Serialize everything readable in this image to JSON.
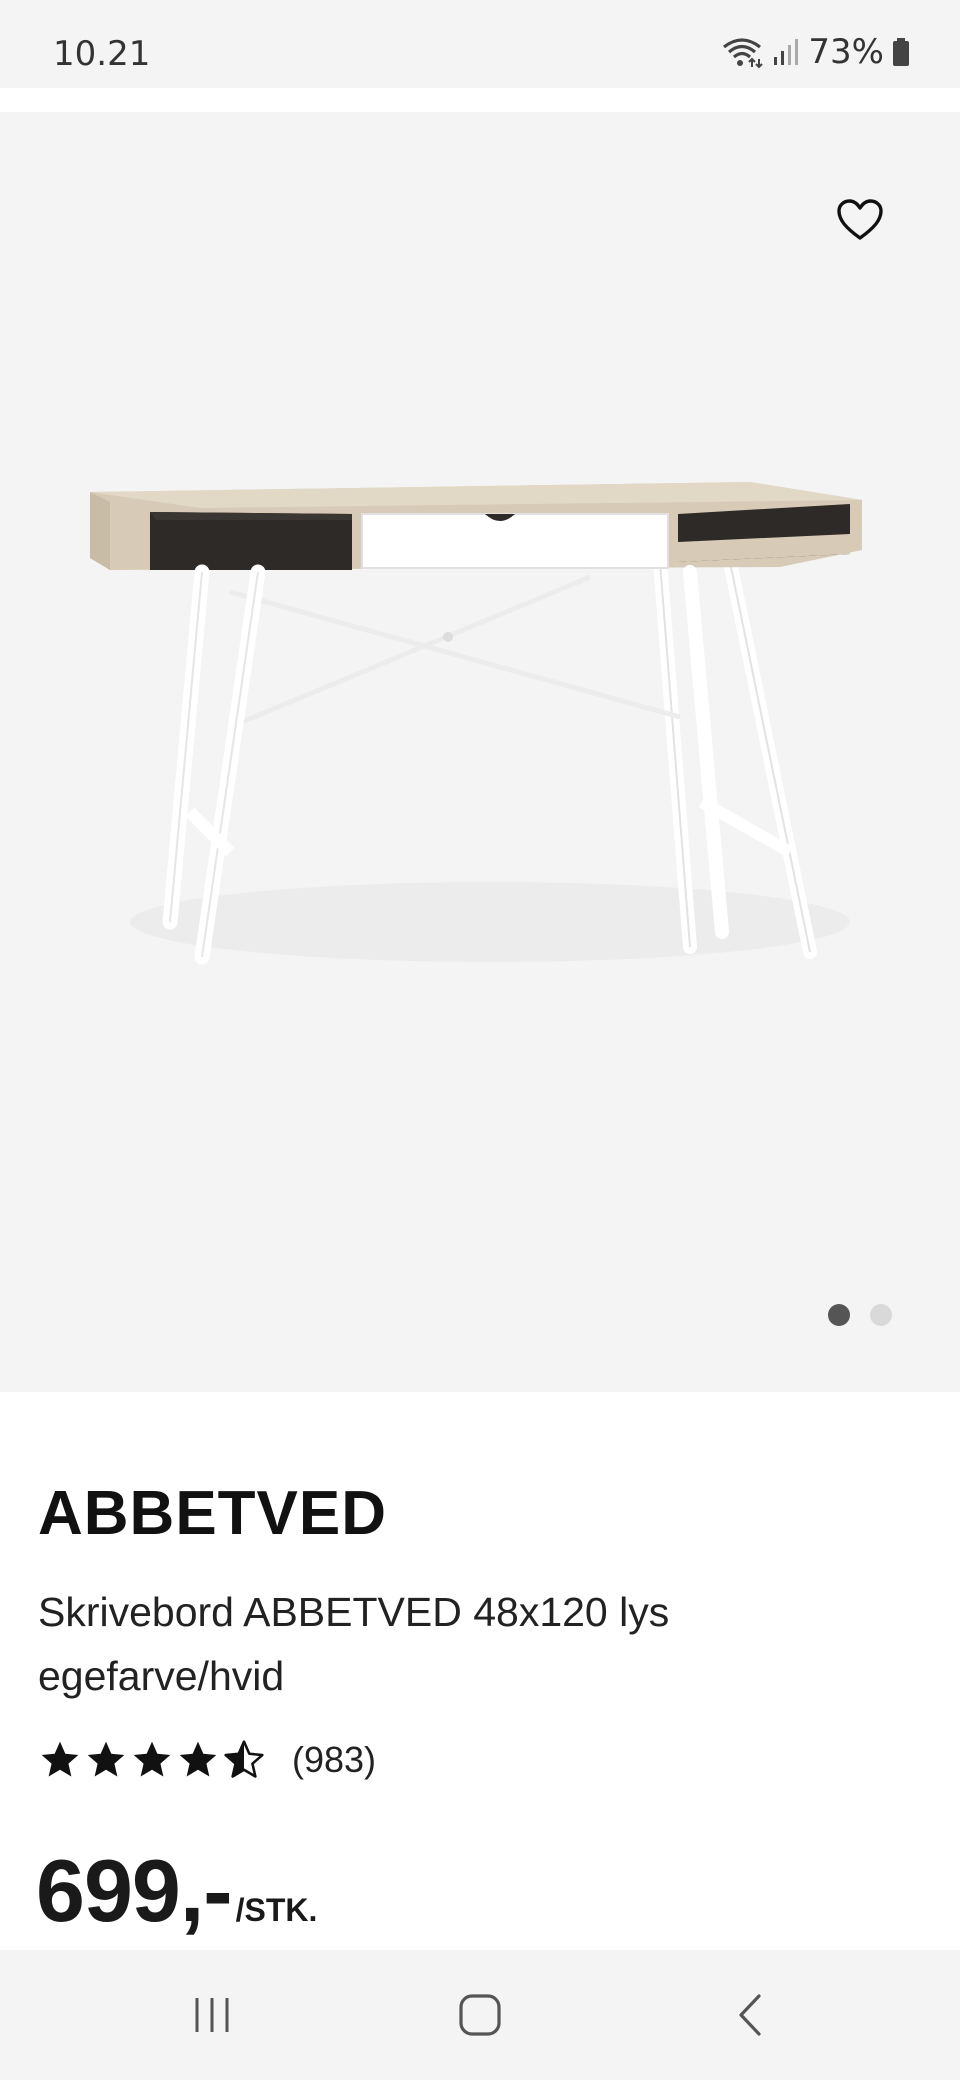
{
  "status_bar": {
    "time": "10.21",
    "battery": "73%"
  },
  "product": {
    "favorite_icon": "heart-outline-icon",
    "image_pager": {
      "count": 2,
      "active_index": 0
    },
    "title": "ABBETVED",
    "description": "Skrivebord ABBETVED 48x120 lys egefarve/hvid",
    "rating": {
      "value": 4.5,
      "max": 5,
      "count_text": "(983)"
    },
    "price": "699,-",
    "price_unit": "/STK."
  },
  "nav_bar": {
    "recents_icon": "recents-icon",
    "home_icon": "home-icon",
    "back_icon": "back-icon"
  },
  "colors": {
    "background": "#f4f4f4",
    "text": "#111111",
    "dot_active": "#555555",
    "dot_inactive": "#d9d9d9"
  }
}
